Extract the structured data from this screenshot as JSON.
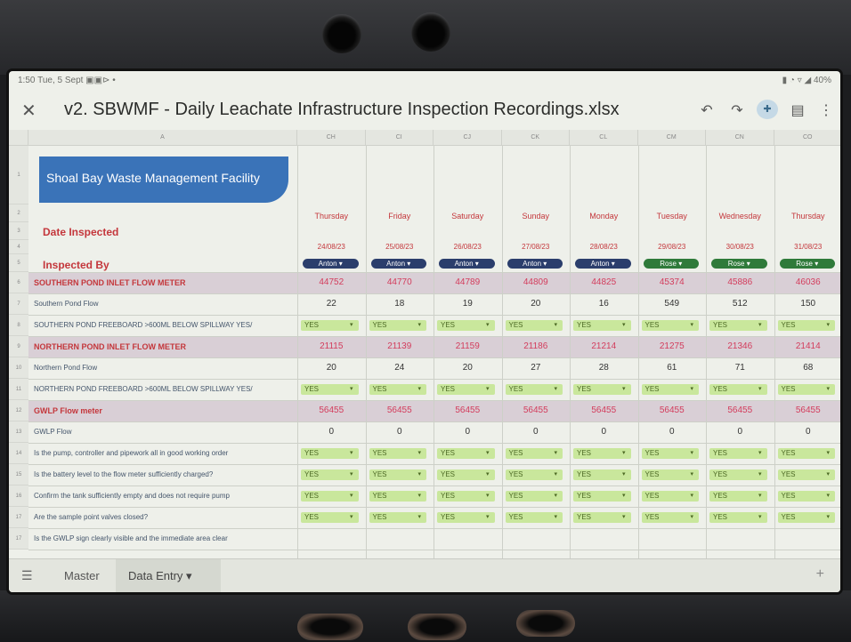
{
  "status": {
    "time": "1:50",
    "date": "Tue, 5 Sept",
    "battery": "40%"
  },
  "app": {
    "title": "v2. SBWMF - Daily Leachate Infrastructure Inspection Recordings.xlsx",
    "icons": [
      "close-icon",
      "undo-icon",
      "redo-icon",
      "share-icon",
      "comments-icon",
      "more-icon"
    ]
  },
  "sheet": {
    "col_a": "A",
    "columns": [
      "CH",
      "CI",
      "CJ",
      "CK",
      "CL",
      "CM",
      "CN",
      "CO"
    ],
    "banner": "Shoal Bay Waste Management Facility",
    "date_label": "Date Inspected",
    "inspected_label": "Inspected By",
    "days": [
      "Thursday",
      "Friday",
      "Saturday",
      "Sunday",
      "Monday",
      "Tuesday",
      "Wednesday",
      "Thursday"
    ],
    "dates": [
      "24/08/23",
      "25/08/23",
      "26/08/23",
      "27/08/23",
      "28/08/23",
      "29/08/23",
      "30/08/23",
      "31/08/23"
    ],
    "inspectors": [
      "Anton",
      "Anton",
      "Anton",
      "Anton",
      "Anton",
      "Rose",
      "Rose",
      "Rose"
    ],
    "rows": [
      {
        "label": "SOUTHERN POND INLET FLOW METER",
        "style": "hi",
        "type": "num",
        "values": [
          "44752",
          "44770",
          "44789",
          "44809",
          "44825",
          "45374",
          "45886",
          "46036"
        ]
      },
      {
        "label": "Southern Pond Flow",
        "style": "",
        "type": "num",
        "values": [
          "22",
          "18",
          "19",
          "20",
          "16",
          "549",
          "512",
          "150"
        ]
      },
      {
        "label": "SOUTHERN POND FREEBOARD >600ML BELOW SPILLWAY YES/",
        "style": "",
        "type": "yes",
        "values": [
          "YES",
          "YES",
          "YES",
          "YES",
          "YES",
          "YES",
          "YES",
          "YES"
        ]
      },
      {
        "label": "NORTHERN POND INLET FLOW METER",
        "style": "hi",
        "type": "num",
        "values": [
          "21115",
          "21139",
          "21159",
          "21186",
          "21214",
          "21275",
          "21346",
          "21414"
        ]
      },
      {
        "label": "Northern Pond Flow",
        "style": "",
        "type": "num",
        "values": [
          "20",
          "24",
          "20",
          "27",
          "28",
          "61",
          "71",
          "68"
        ]
      },
      {
        "label": "NORTHERN POND FREEBOARD >600ML BELOW SPILLWAY YES/",
        "style": "",
        "type": "yes",
        "values": [
          "YES",
          "YES",
          "YES",
          "YES",
          "YES",
          "YES",
          "YES",
          "YES"
        ]
      },
      {
        "label": "GWLP Flow meter",
        "style": "hi",
        "type": "num",
        "values": [
          "56455",
          "56455",
          "56455",
          "56455",
          "56455",
          "56455",
          "56455",
          "56455"
        ]
      },
      {
        "label": "GWLP Flow",
        "style": "",
        "type": "num",
        "values": [
          "0",
          "0",
          "0",
          "0",
          "0",
          "0",
          "0",
          "0"
        ]
      },
      {
        "label": "Is the pump, controller and pipework all in good working order",
        "style": "",
        "type": "yes",
        "values": [
          "YES",
          "YES",
          "YES",
          "YES",
          "YES",
          "YES",
          "YES",
          "YES"
        ]
      },
      {
        "label": "Is the battery level to the flow meter sufficiently charged?",
        "style": "",
        "type": "yes",
        "values": [
          "YES",
          "YES",
          "YES",
          "YES",
          "YES",
          "YES",
          "YES",
          "YES"
        ]
      },
      {
        "label": "Confirm the tank sufficiently empty and does not require pump",
        "style": "",
        "type": "yes",
        "values": [
          "YES",
          "YES",
          "YES",
          "YES",
          "YES",
          "YES",
          "YES",
          "YES"
        ]
      },
      {
        "label": "Are the sample point valves closed?",
        "style": "",
        "type": "yes",
        "values": [
          "YES",
          "YES",
          "YES",
          "YES",
          "YES",
          "YES",
          "YES",
          "YES"
        ]
      },
      {
        "label": "Is the GWLP sign clearly visible and the immediate area clear",
        "style": "",
        "type": "none",
        "values": [
          "",
          "",
          "",
          "",
          "",
          "",
          "",
          ""
        ]
      }
    ],
    "row_numbers": [
      "1",
      "2",
      "3",
      "4",
      "5",
      "6",
      "7",
      "8",
      "9",
      "10",
      "11",
      "12",
      "13",
      "14",
      "15",
      "16",
      "17"
    ]
  },
  "tabs": {
    "items": [
      "Master",
      "Data Entry"
    ],
    "active": "Data Entry"
  },
  "colors": {
    "anton": "#2b3e6c",
    "rose": "#2f7a3a",
    "yes": "#c9e79c",
    "red": "#c4373c",
    "banner": "#3a73b8"
  }
}
